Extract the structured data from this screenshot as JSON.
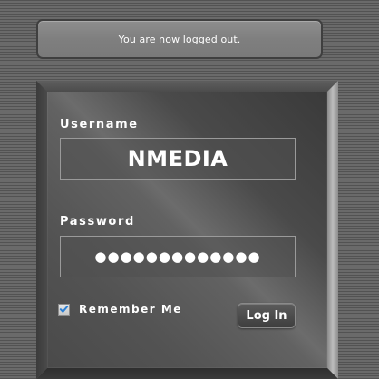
{
  "message": {
    "text": "You are now logged out."
  },
  "login_form": {
    "username_label": "Username",
    "username_value": "NMEDIA",
    "password_label": "Password",
    "password_value": "●●●●●●●●●●●●●",
    "remember_label": "Remember Me",
    "remember_checked": true,
    "login_button_label": "Log In"
  },
  "colors": {
    "background": "#5a5a5a",
    "panel": "#555555",
    "text": "#ffffff",
    "checkmark": "#2a7fd4"
  },
  "icons": {
    "checkbox": "checkmark-icon"
  }
}
